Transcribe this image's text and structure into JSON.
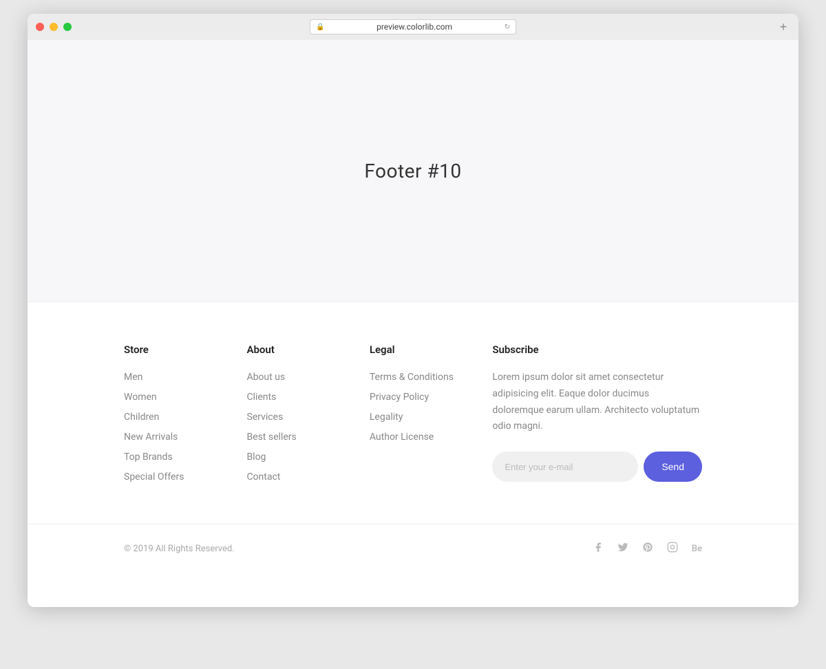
{
  "browser": {
    "url": "preview.colorlib.com",
    "new_tab_label": "+"
  },
  "page": {
    "title": "Footer #10"
  },
  "footer": {
    "store": {
      "heading": "Store",
      "links": [
        "Men",
        "Women",
        "Children",
        "New Arrivals",
        "Top Brands",
        "Special Offers"
      ]
    },
    "about": {
      "heading": "About",
      "links": [
        "About us",
        "Clients",
        "Services",
        "Best sellers",
        "Blog",
        "Contact"
      ]
    },
    "legal": {
      "heading": "Legal",
      "links": [
        "Terms & Conditions",
        "Privacy Policy",
        "Legality",
        "Author License"
      ]
    },
    "subscribe": {
      "heading": "Subscribe",
      "description": "Lorem ipsum dolor sit amet consectetur adipisicing elit. Eaque dolor ducimus doloremque earum ullam. Architecto voluptatum odio magni.",
      "email_placeholder": "Enter your e-mail",
      "send_label": "Send"
    },
    "bottom": {
      "copyright": "© 2019 All Rights Reserved.",
      "social": [
        {
          "name": "facebook",
          "icon": "f"
        },
        {
          "name": "twitter",
          "icon": "t"
        },
        {
          "name": "pinterest",
          "icon": "p"
        },
        {
          "name": "instagram",
          "icon": "i"
        },
        {
          "name": "behance",
          "icon": "Be"
        }
      ]
    }
  }
}
